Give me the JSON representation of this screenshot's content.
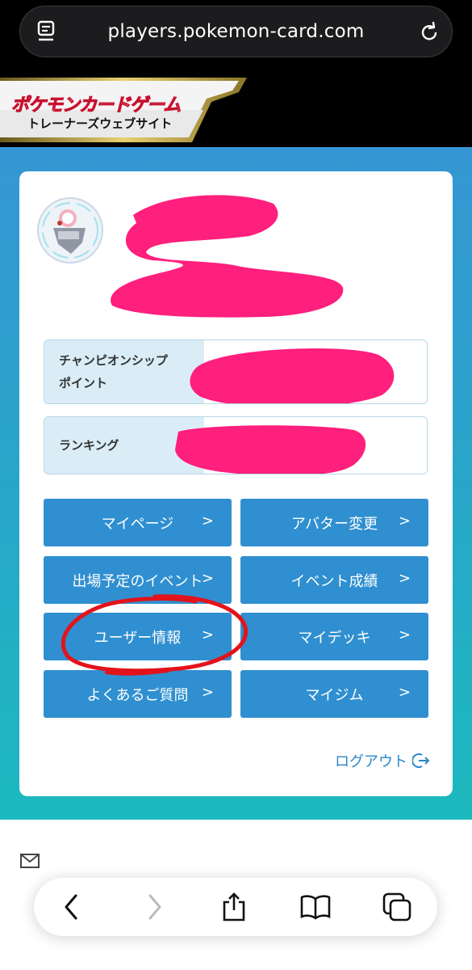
{
  "browser": {
    "url": "players.pokemon-card.com"
  },
  "site_header": {
    "logo_title": "ポケモンカードゲーム",
    "logo_subtitle": "トレーナーズウェブサイト"
  },
  "profile": {
    "stats": [
      {
        "label_line1": "チャンピオンシップ",
        "label_line2": "ポイント"
      },
      {
        "label_line1": "ランキング",
        "label_line2": ""
      }
    ]
  },
  "menu": {
    "buttons": [
      {
        "label": "マイページ"
      },
      {
        "label": "アバター変更"
      },
      {
        "label": "出場予定のイベント"
      },
      {
        "label": "イベント成績"
      },
      {
        "label": "ユーザー情報"
      },
      {
        "label": "マイデッキ"
      },
      {
        "label": "よくあるご質問"
      },
      {
        "label": "マイジム"
      }
    ],
    "chevron": ">",
    "logout_label": "ログアウト"
  },
  "colors": {
    "button_blue": "#2f8fd0",
    "annotation_red": "#e3131b",
    "redaction_pink": "#ff1f7d"
  }
}
